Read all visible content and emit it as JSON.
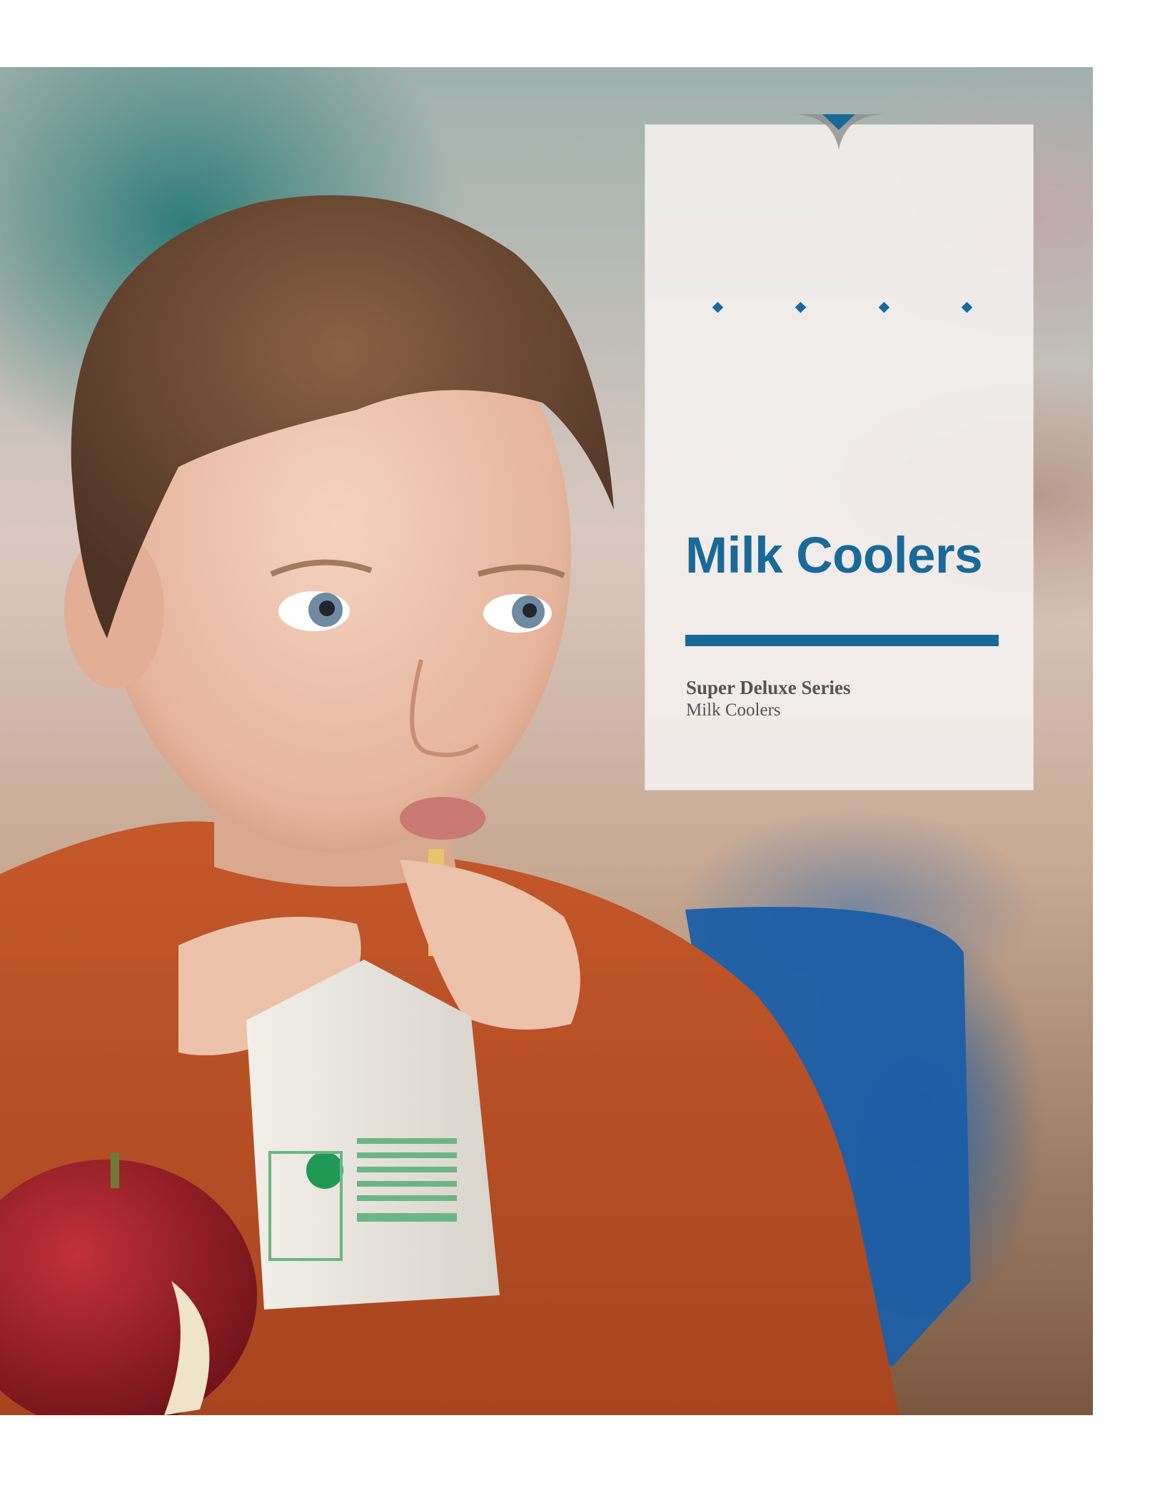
{
  "cover": {
    "title": "Milk Coolers",
    "series": "Super Deluxe Series",
    "subtitle": "Milk Coolers"
  },
  "colors": {
    "accent": "#1a6a99",
    "text_gray": "#555555",
    "card": "#f4f1f0"
  },
  "photo": {
    "subject": "boy drinking from milk carton with an apple"
  }
}
